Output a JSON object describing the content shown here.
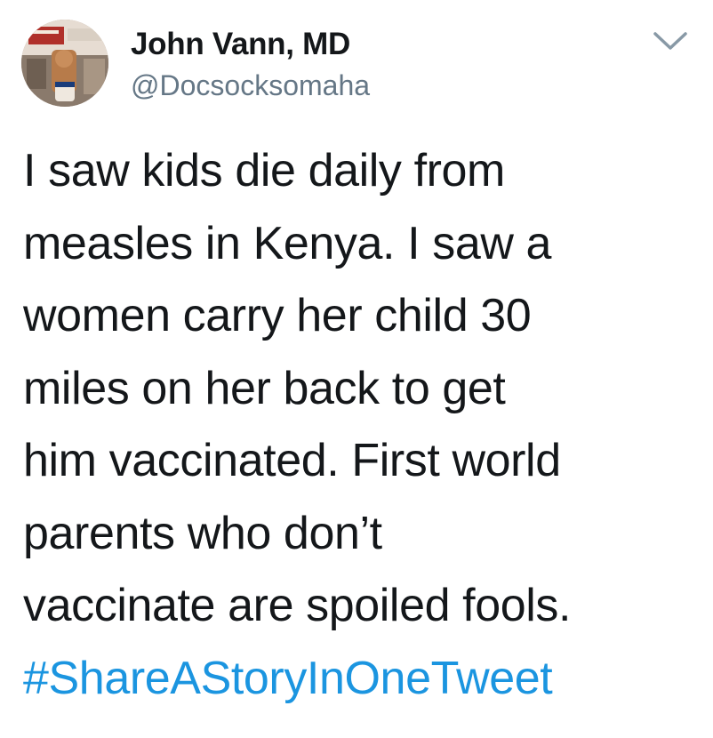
{
  "author": {
    "display_name": "John Vann, MD",
    "handle": "@Docsocksomaha"
  },
  "icons": {
    "menu": "chevron-down-icon",
    "avatar": "profile-photo"
  },
  "tweet": {
    "lines": [
      "I saw kids die daily from",
      "measles in Kenya. I saw a",
      "women carry her child 30",
      "miles on her back to get",
      "him vaccinated. First world",
      "parents who don’t",
      "vaccinate are spoiled fools."
    ],
    "hashtag": "#ShareAStoryInOneTweet"
  },
  "colors": {
    "text": "#14171a",
    "secondary": "#657786",
    "link": "#1b95e0",
    "chevron": "#8899a6"
  }
}
